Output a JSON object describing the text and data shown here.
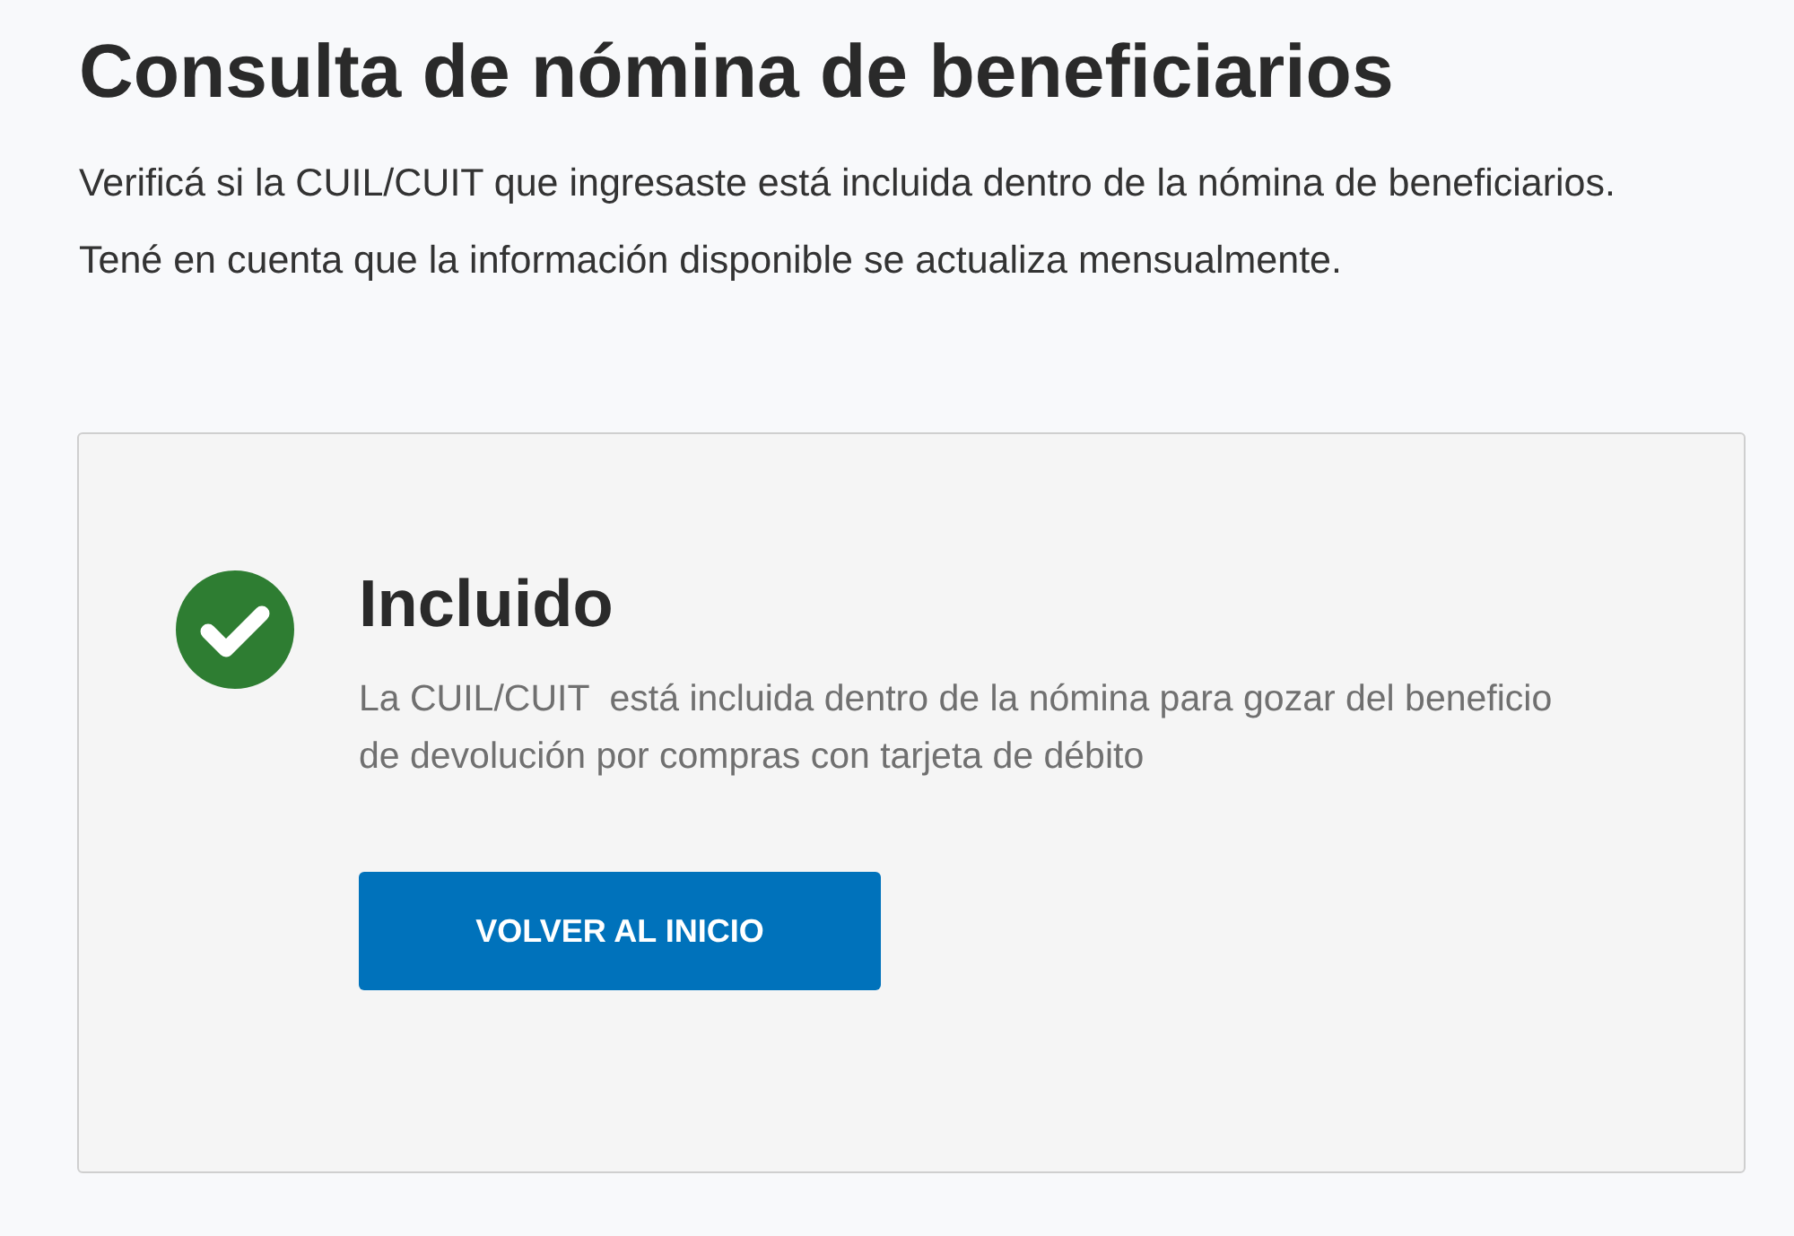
{
  "page": {
    "title": "Consulta de nómina de beneficiarios",
    "intro": [
      "Verificá si la CUIL/CUIT que ingresaste está incluida dentro de la nómina de beneficiarios.",
      "Tené en cuenta que la información disponible se actualiza mensualmente."
    ]
  },
  "result": {
    "kind": "success",
    "heading": "Incluido",
    "message": "La CUIL/CUIT  está incluida dentro de la nómina para gozar del beneficio de devolución por compras con tarjeta de débito",
    "button": "VOLVER AL INICIO"
  }
}
